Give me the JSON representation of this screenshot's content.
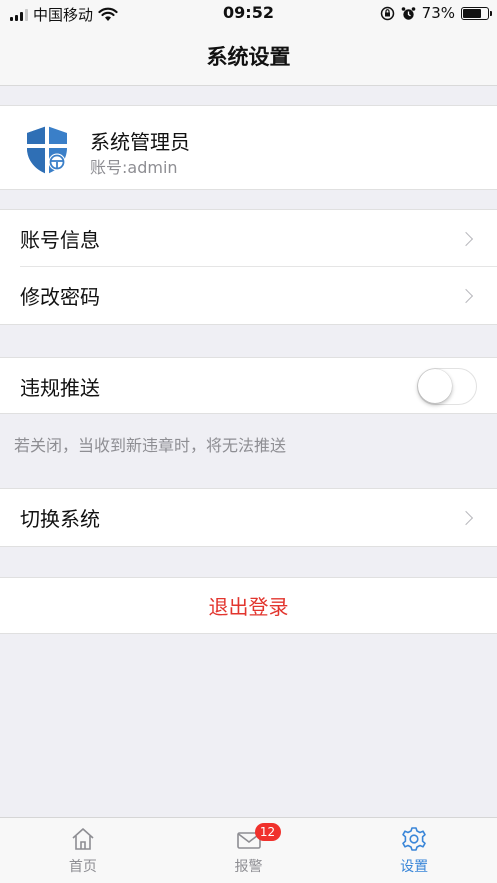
{
  "status_bar": {
    "carrier": "中国移动",
    "time": "09:52",
    "battery": "73%",
    "battery_level": 0.73
  },
  "nav": {
    "title": "系统设置"
  },
  "profile": {
    "name": "系统管理员",
    "account": "账号:admin",
    "icon": "shield-steering-wheel-icon"
  },
  "menu": {
    "account_info": "账号信息",
    "change_password": "修改密码",
    "violation_push": "违规推送",
    "violation_push_enabled": false,
    "push_hint": "若关闭，当收到新违章时，将无法推送",
    "switch_system": "切换系统",
    "logout": "退出登录"
  },
  "tabs": [
    {
      "label": "首页",
      "icon": "home-icon"
    },
    {
      "label": "报警",
      "icon": "mail-icon",
      "badge": "12"
    },
    {
      "label": "设置",
      "icon": "gear-icon"
    }
  ],
  "colors": {
    "accent": "#3a86d8",
    "danger": "#e2352e",
    "badge": "#f0312c",
    "background": "#efeff4"
  }
}
